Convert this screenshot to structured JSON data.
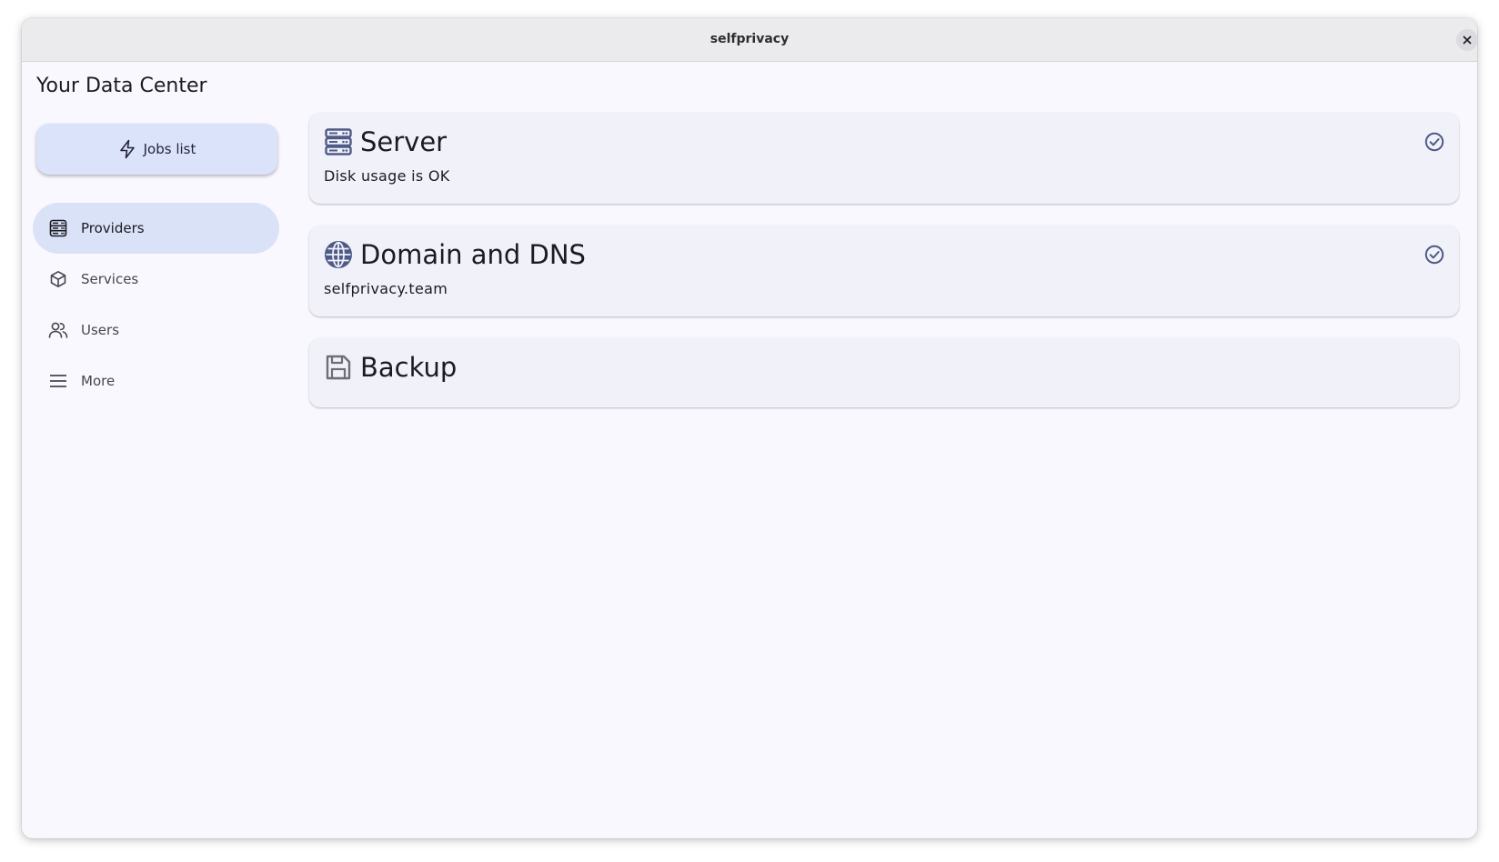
{
  "window": {
    "title": "selfprivacy"
  },
  "page": {
    "title": "Your Data Center"
  },
  "jobs_button": {
    "label": "Jobs list",
    "icon": "lightning-icon"
  },
  "nav": {
    "items": [
      {
        "label": "Providers",
        "icon": "server-icon",
        "active": true
      },
      {
        "label": "Services",
        "icon": "box-icon",
        "active": false
      },
      {
        "label": "Users",
        "icon": "users-icon",
        "active": false
      },
      {
        "label": "More",
        "icon": "menu-icon",
        "active": false
      }
    ]
  },
  "cards": [
    {
      "title": "Server",
      "subtitle": "Disk usage is OK",
      "icon": "server-icon",
      "status": "check-circle-icon"
    },
    {
      "title": "Domain and DNS",
      "subtitle": "selfprivacy.team",
      "icon": "globe-icon",
      "status": "check-circle-icon"
    },
    {
      "title": "Backup",
      "subtitle": "",
      "icon": "floppy-disk-icon",
      "status": ""
    }
  ],
  "colors": {
    "accent": "#4f5a87",
    "active_nav_bg": "#dae2f7",
    "jobs_button_bg": "#dbe3fb",
    "card_bg": "#f1f2f9",
    "window_bg": "#f9f8ff"
  }
}
